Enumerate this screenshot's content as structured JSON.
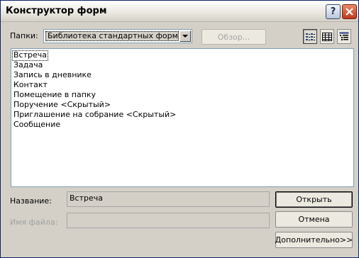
{
  "window": {
    "title": "Конструктор форм",
    "help_label": "?"
  },
  "folders": {
    "label": "Папки:",
    "selected": "Библиотека стандартных форм",
    "browse_label": "Обзор..."
  },
  "view_buttons": [
    "icons-view",
    "list-view",
    "details-view"
  ],
  "list": {
    "items": [
      "Встреча",
      "Задача",
      "Запись в дневнике",
      "Контакт",
      "Помещение в папку",
      "Поручение <Скрытый>",
      "Приглашение на собрание <Скрытый>",
      "Сообщение"
    ],
    "selected_index": 0
  },
  "details": {
    "name_label": "Название:",
    "name_value": "Встреча",
    "filename_label": "Имя файла:",
    "filename_value": ""
  },
  "actions": {
    "open_label": "Открыть",
    "cancel_label": "Отмена",
    "advanced_label": "Дополнительно>>"
  },
  "colors": {
    "accent_border": "#7f9db9",
    "face": "#d4d0c8",
    "close_red": "#c0391b"
  }
}
